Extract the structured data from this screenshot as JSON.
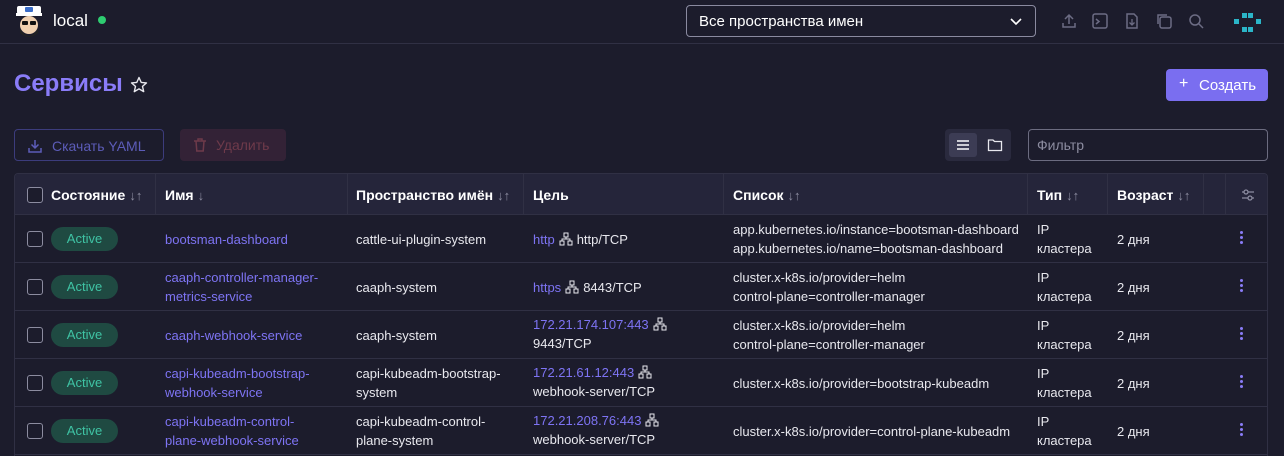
{
  "header": {
    "cluster_name": "local",
    "namespace_select": "Все пространства имен"
  },
  "page": {
    "title": "Сервисы",
    "create_label": "Создать"
  },
  "toolbar": {
    "download_label": "Скачать YAML",
    "delete_label": "Удалить",
    "filter_placeholder": "Фильтр"
  },
  "table": {
    "columns": [
      "Состояние",
      "Имя",
      "Пространство имён",
      "Цель",
      "Список",
      "Тип",
      "Возраст"
    ],
    "rows": [
      {
        "state": "Active",
        "name": [
          "bootsman-dashboard"
        ],
        "namespace": [
          "cattle-ui-plugin-system"
        ],
        "target_link": "http",
        "target_port": "http/TCP",
        "selector": [
          "app.kubernetes.io/instance=bootsman-dashboard",
          "app.kubernetes.io/name=bootsman-dashboard"
        ],
        "type": [
          "IP",
          "кластера"
        ],
        "age": "2 дня"
      },
      {
        "state": "Active",
        "name": [
          "caaph-controller-manager-",
          "metrics-service"
        ],
        "namespace": [
          "caaph-system"
        ],
        "target_link": "https",
        "target_port": "8443/TCP",
        "selector": [
          "cluster.x-k8s.io/provider=helm",
          "control-plane=controller-manager"
        ],
        "type": [
          "IP",
          "кластера"
        ],
        "age": "2 дня"
      },
      {
        "state": "Active",
        "name": [
          "caaph-webhook-service"
        ],
        "namespace": [
          "caaph-system"
        ],
        "target_link": "172.21.174.107:443",
        "target_port": "9443/TCP",
        "selector": [
          "cluster.x-k8s.io/provider=helm",
          "control-plane=controller-manager"
        ],
        "type": [
          "IP",
          "кластера"
        ],
        "age": "2 дня"
      },
      {
        "state": "Active",
        "name": [
          "capi-kubeadm-bootstrap-",
          "webhook-service"
        ],
        "namespace": [
          "capi-kubeadm-bootstrap-",
          "system"
        ],
        "target_link": "172.21.61.12:443",
        "target_port": "webhook-server/TCP",
        "selector": [
          "cluster.x-k8s.io/provider=bootstrap-kubeadm"
        ],
        "type": [
          "IP",
          "кластера"
        ],
        "age": "2 дня"
      },
      {
        "state": "Active",
        "name": [
          "capi-kubeadm-control-",
          "plane-webhook-service"
        ],
        "namespace": [
          "capi-kubeadm-control-",
          "plane-system"
        ],
        "target_link": "172.21.208.76:443",
        "target_port": "webhook-server/TCP",
        "selector": [
          "cluster.x-k8s.io/provider=control-plane-kubeadm"
        ],
        "type": [
          "IP",
          "кластера"
        ],
        "age": "2 дня"
      }
    ]
  },
  "colors": {
    "accent": "#7a6ef0",
    "active_badge": "#3fc3a4",
    "background": "#1c1c2c"
  }
}
